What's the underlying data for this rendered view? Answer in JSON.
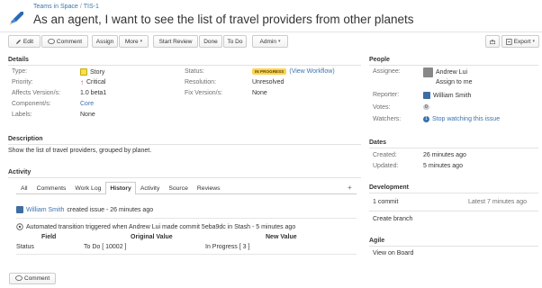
{
  "header": {
    "breadcrumb_project": "Teams in Space",
    "breadcrumb_sep": "/",
    "breadcrumb_issue": "TIS-1",
    "title": "As an agent, I want to see the list of travel providers from other planets"
  },
  "toolbar": {
    "edit": "Edit",
    "comment": "Comment",
    "assign": "Assign",
    "more": "More",
    "start_review": "Start Review",
    "done": "Done",
    "to_do": "To Do",
    "admin": "Admin",
    "export": "Export"
  },
  "details": {
    "heading": "Details",
    "type_label": "Type:",
    "type_value": "Story",
    "priority_label": "Priority:",
    "priority_value": "Critical",
    "affects_label": "Affects Version/s:",
    "affects_value": "1.0 beta1",
    "components_label": "Component/s:",
    "components_value": "Core",
    "labels_label": "Labels:",
    "labels_value": "None",
    "status_label": "Status:",
    "status_badge": "IN PROGRESS",
    "status_workflow": "(View Workflow)",
    "resolution_label": "Resolution:",
    "resolution_value": "Unresolved",
    "fix_label": "Fix Version/s:",
    "fix_value": "None"
  },
  "description": {
    "heading": "Description",
    "text": "Show the list of travel providers, grouped by planet."
  },
  "activity": {
    "heading": "Activity",
    "tabs": [
      "All",
      "Comments",
      "Work Log",
      "History",
      "Activity",
      "Source",
      "Reviews"
    ],
    "selected_tab": "History",
    "plus": "+",
    "entry1_user": "William Smith",
    "entry1_text": "created issue - 26 minutes ago",
    "entry2_text": "Automated transition triggered when Andrew Lui made commit 5eba9dc in Stash - 5 minutes ago",
    "col_field": "Field",
    "col_original": "Original Value",
    "col_new": "New Value",
    "row_field": "Status",
    "row_original": "To Do  [ 10002 ]",
    "row_new": "In Progress  [ 3 ]",
    "comment_button": "Comment"
  },
  "people": {
    "heading": "People",
    "assignee_label": "Assignee:",
    "assignee_value": "Andrew Lui",
    "assign_to_me": "Assign to me",
    "reporter_label": "Reporter:",
    "reporter_value": "William Smith",
    "votes_label": "Votes:",
    "votes_value": "0",
    "watchers_label": "Watchers:",
    "watchers_count": "1",
    "watchers_value": "Stop watching this issue"
  },
  "dates": {
    "heading": "Dates",
    "created_label": "Created:",
    "created_value": "26 minutes ago",
    "updated_label": "Updated:",
    "updated_value": "5 minutes ago"
  },
  "development": {
    "heading": "Development",
    "commits": "1 commit",
    "latest": "Latest 7 minutes ago",
    "create_branch": "Create branch"
  },
  "agile": {
    "heading": "Agile",
    "view_board": "View on Board"
  },
  "colors": {
    "link": "#3b73af",
    "badge_bg": "#ffd351",
    "critical": "#d04437"
  }
}
